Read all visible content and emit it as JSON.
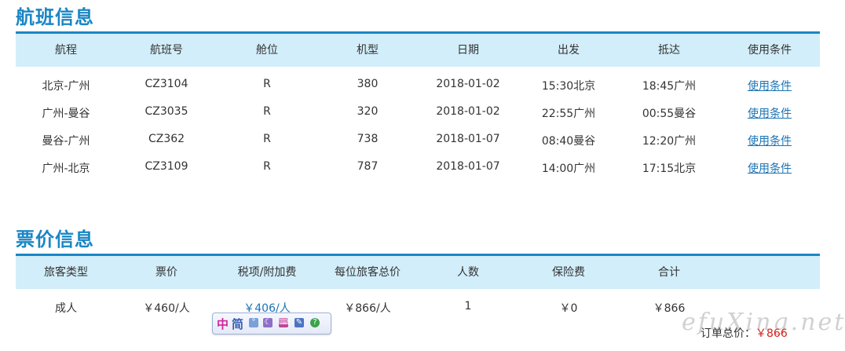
{
  "flight_section": {
    "title": "航班信息",
    "columns": [
      "航程",
      "航班号",
      "舱位",
      "机型",
      "日期",
      "出发",
      "抵达",
      "使用条件"
    ],
    "rows": [
      {
        "route": "北京-广州",
        "flight_no": "CZ3104",
        "cabin": "R",
        "aircraft": "380",
        "date": "2018-01-02",
        "depart": "15:30北京",
        "arrive": "18:45广州",
        "conditions": "使用条件"
      },
      {
        "route": "广州-曼谷",
        "flight_no": "CZ3035",
        "cabin": "R",
        "aircraft": "320",
        "date": "2018-01-02",
        "depart": "22:55广州",
        "arrive": "00:55曼谷",
        "conditions": "使用条件"
      },
      {
        "route": "曼谷-广州",
        "flight_no": "CZ362",
        "cabin": "R",
        "aircraft": "738",
        "date": "2018-01-07",
        "depart": "08:40曼谷",
        "arrive": "12:20广州",
        "conditions": "使用条件"
      },
      {
        "route": "广州-北京",
        "flight_no": "CZ3109",
        "cabin": "R",
        "aircraft": "787",
        "date": "2018-01-07",
        "depart": "14:00广州",
        "arrive": "17:15北京",
        "conditions": "使用条件"
      }
    ]
  },
  "fare_section": {
    "title": "票价信息",
    "columns": [
      "旅客类型",
      "票价",
      "税项/附加费",
      "每位旅客总价",
      "人数",
      "保险费",
      "合计"
    ],
    "rows": [
      {
        "passenger_type": "成人",
        "fare": "￥460/人",
        "tax": "￥406/人",
        "per_person_total": "￥866/人",
        "count": "1",
        "insurance": "￥0",
        "total": "￥866"
      }
    ]
  },
  "order_total": {
    "label": "订单总价：",
    "value": "￥866"
  },
  "watermark": "efuXing.net",
  "ime_toolbar": {
    "mode": "中",
    "charset": "简"
  },
  "colors": {
    "accent": "#1a86c5",
    "header_bg": "#d2eefa",
    "link": "#1a74b5",
    "price_red": "#d9231d"
  }
}
